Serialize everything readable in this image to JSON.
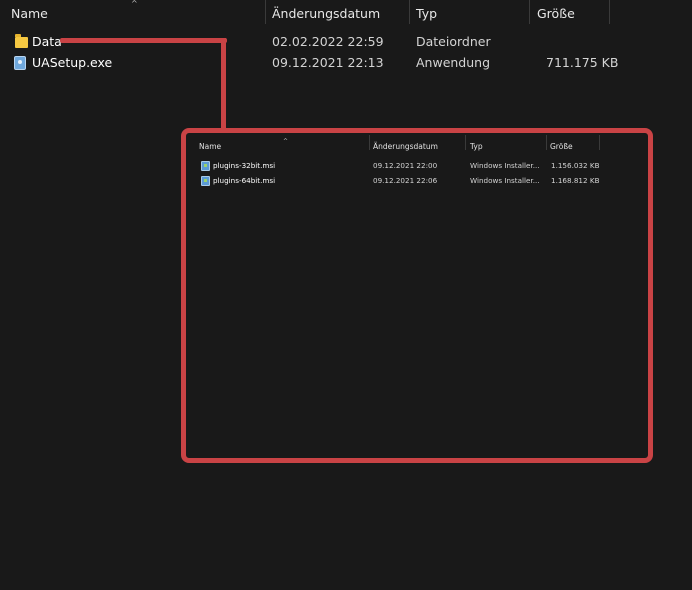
{
  "columns": {
    "name": "Name",
    "date": "Änderungsdatum",
    "type": "Typ",
    "size": "Größe"
  },
  "files": [
    {
      "name": "Data",
      "date": "02.02.2022 22:59",
      "type": "Dateiordner",
      "size": "",
      "icon": "folder-icon"
    },
    {
      "name": "UASetup.exe",
      "date": "09.12.2021 22:13",
      "type": "Anwendung",
      "size": "711.175 KB",
      "icon": "installer-exe-icon"
    }
  ],
  "inset": {
    "columns": {
      "name": "Name",
      "date": "Änderungsdatum",
      "type": "Typ",
      "size": "Größe"
    },
    "files": [
      {
        "name": "plugins-32bit.msi",
        "date": "09.12.2021 22:00",
        "type": "Windows Installer...",
        "size": "1.156.032 KB",
        "icon": "msi-icon"
      },
      {
        "name": "plugins-64bit.msi",
        "date": "09.12.2021 22:06",
        "type": "Windows Installer...",
        "size": "1.168.812 KB",
        "icon": "msi-icon"
      }
    ]
  },
  "colors": {
    "background": "#191919",
    "highlight": "#c94345",
    "folder": "#f5c842"
  }
}
